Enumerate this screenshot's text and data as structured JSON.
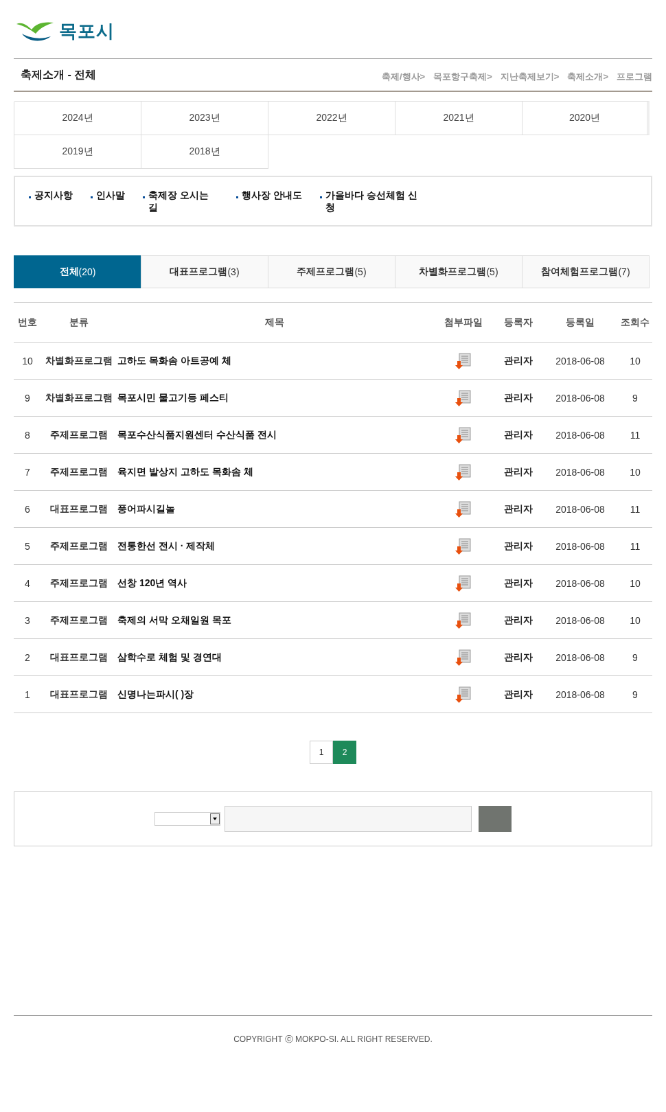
{
  "logo": {
    "text": "목포시"
  },
  "page_title": "축제소개 - 전체",
  "breadcrumb": [
    "축제/행사>",
    "목포항구축제>",
    "지난축제보기>",
    "축제소개>",
    "프로그램"
  ],
  "year_tabs": [
    "2024년",
    "2023년",
    "2022년",
    "2021년",
    "2020년",
    "2019년",
    "2018년"
  ],
  "menu": [
    "공지사항",
    "인사말",
    "축제장 오시는 길",
    "행사장 안내도",
    "가을바다 승선체험 신청"
  ],
  "category_tabs": [
    {
      "label": "**전체**(20)",
      "selected": true
    },
    {
      "label": "**대표프로그램**(3)",
      "selected": false
    },
    {
      "label": "**주제프로그램**(5)",
      "selected": false
    },
    {
      "label": "**차별화프로그램**(5)",
      "selected": false
    },
    {
      "label": "**참여체험프로그램**(7)",
      "selected": false
    }
  ],
  "table": {
    "columns": [
      "번호",
      "분류",
      "제목",
      "첨부파일",
      "등록자",
      "등록일",
      "조회수"
    ],
    "rows": [
      {
        "no": "10",
        "category": "차별화프로그램",
        "title": "고하도 목화솜 아트공예 체",
        "author": "관리자",
        "date": "2018-06-08",
        "views": "10"
      },
      {
        "no": "9",
        "category": "차별화프로그램",
        "title": "목포시민 물고기등 페스티",
        "author": "관리자",
        "date": "2018-06-08",
        "views": "9"
      },
      {
        "no": "8",
        "category": "주제프로그램",
        "title": "목포수산식품지원센터 수산식품 전시",
        "author": "관리자",
        "date": "2018-06-08",
        "views": "11"
      },
      {
        "no": "7",
        "category": "주제프로그램",
        "title": "육지면 발상지 고하도 목화솜 체",
        "author": "관리자",
        "date": "2018-06-08",
        "views": "10"
      },
      {
        "no": "6",
        "category": "대표프로그램",
        "title": "풍어파시길놀",
        "author": "관리자",
        "date": "2018-06-08",
        "views": "11"
      },
      {
        "no": "5",
        "category": "주제프로그램",
        "title": "전통한선 전시 · 제작체",
        "author": "관리자",
        "date": "2018-06-08",
        "views": "11"
      },
      {
        "no": "4",
        "category": "주제프로그램",
        "title": "선창 120년 역사",
        "author": "관리자",
        "date": "2018-06-08",
        "views": "10"
      },
      {
        "no": "3",
        "category": "주제프로그램",
        "title": "축제의 서막 오채일원 목포",
        "author": "관리자",
        "date": "2018-06-08",
        "views": "10"
      },
      {
        "no": "2",
        "category": "대표프로그램",
        "title": "삼학수로 체험 및 경연대",
        "author": "관리자",
        "date": "2018-06-08",
        "views": "9"
      },
      {
        "no": "1",
        "category": "대표프로그램",
        "title": "신명나는파시(  )장",
        "author": "관리자",
        "date": "2018-06-08",
        "views": "9"
      }
    ]
  },
  "pagination": [
    {
      "label": "1",
      "selected": false
    },
    {
      "label": "2",
      "selected": true
    }
  ],
  "footer": "COPYRIGHT ⓒ MOKPO-SI. ALL RIGHT RESERVED."
}
